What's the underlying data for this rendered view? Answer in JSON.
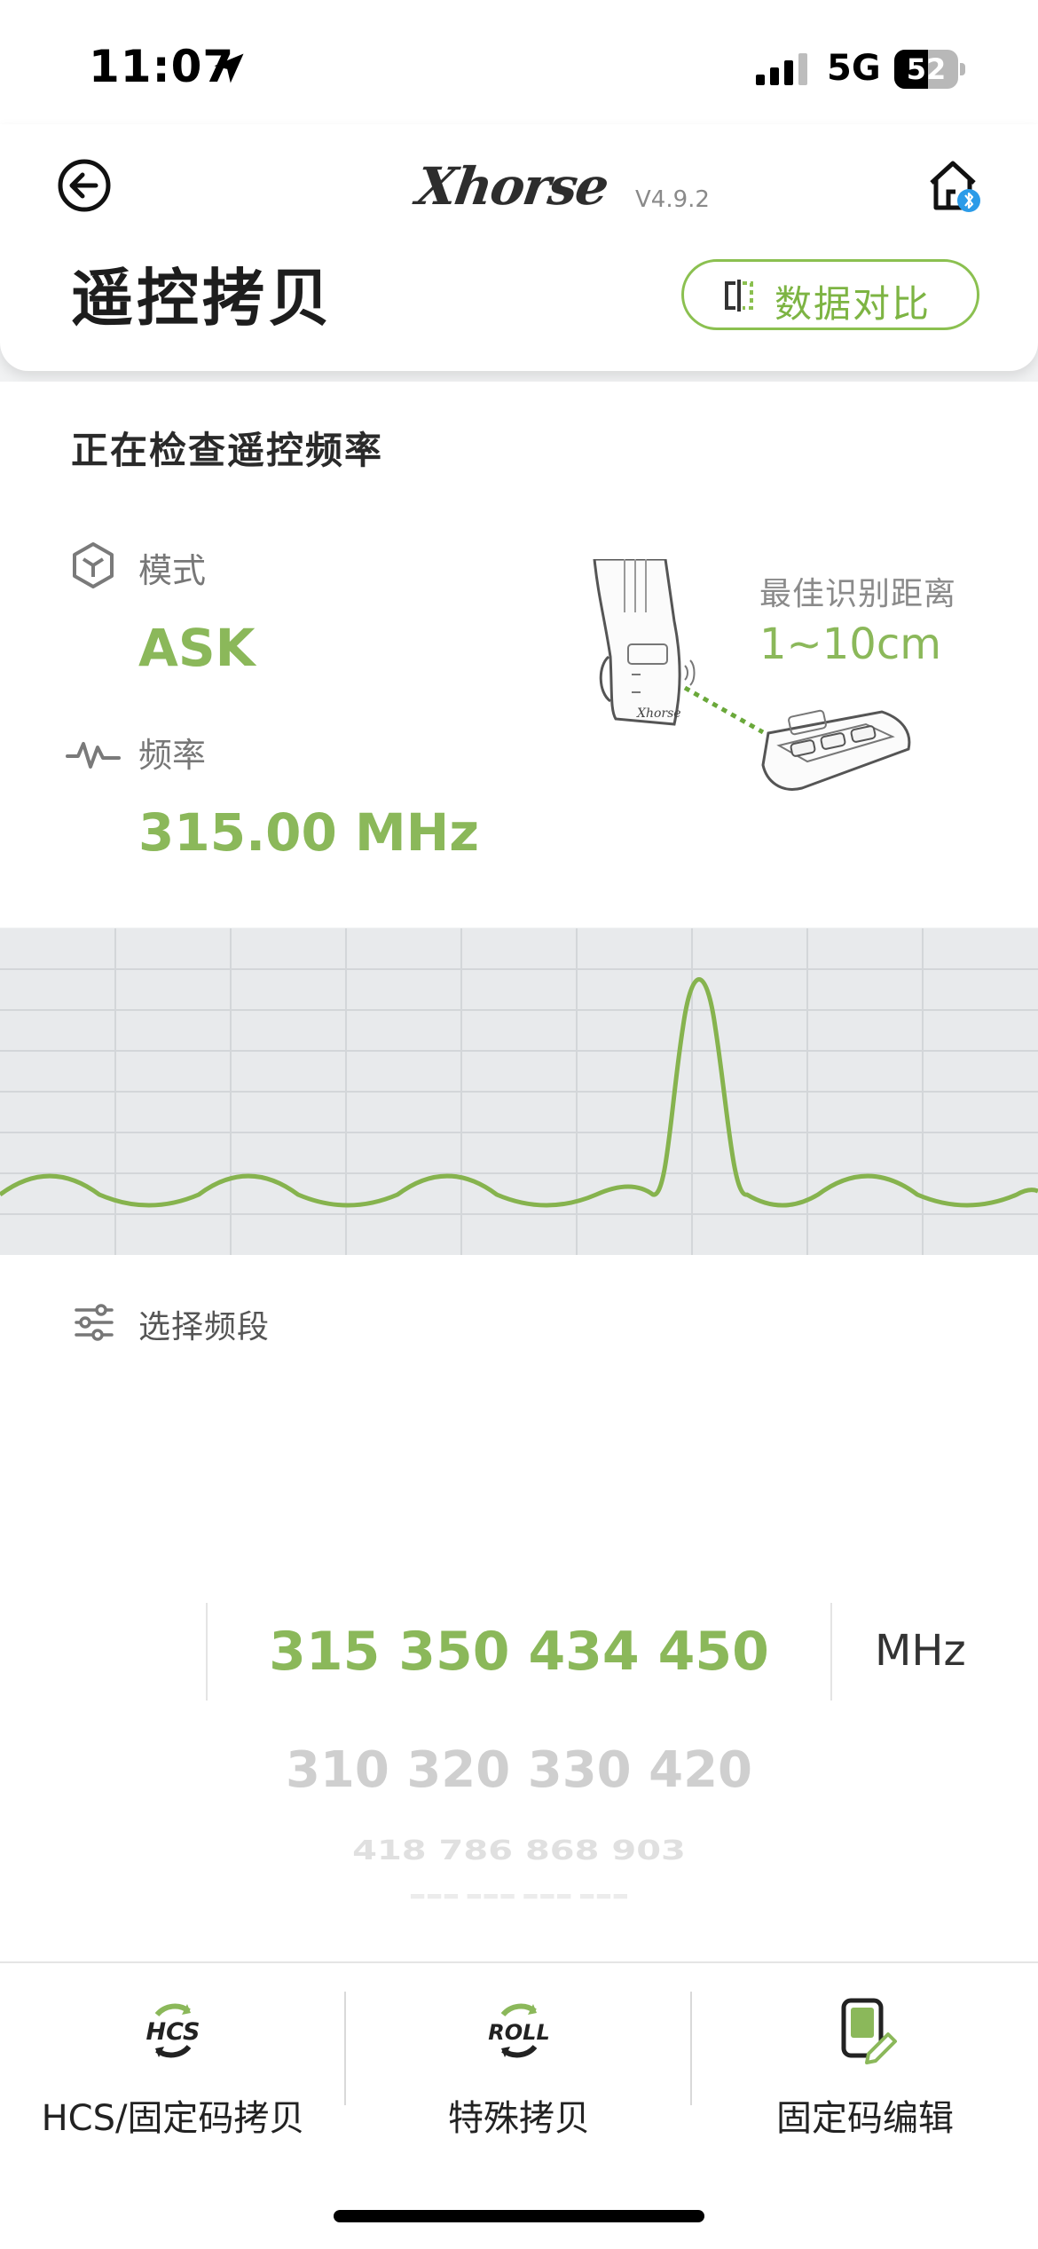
{
  "status_bar": {
    "time": "11:07",
    "network": "5G",
    "battery": "52"
  },
  "header": {
    "brand": "Xhorse",
    "version": "V4.9.2",
    "title": "遥控拷贝",
    "compare_button": "数据对比"
  },
  "detect": {
    "status_text": "正在检查遥控频率",
    "mode_label": "模式",
    "mode_value": "ASK",
    "freq_label": "频率",
    "freq_value": "315.00 MHz",
    "distance_label": "最佳识别距离",
    "distance_value": "1~10cm"
  },
  "band": {
    "label": "选择频段",
    "selected": "315 350 434 450",
    "unit": "MHz",
    "options": [
      "310 320 330 420",
      "418 786 868 903",
      "■■■ ■■■ ■■■ ■■■"
    ]
  },
  "tabs": [
    {
      "label": "HCS/固定码拷贝",
      "icon": "hcs-icon"
    },
    {
      "label": "特殊拷贝",
      "icon": "roll-icon"
    },
    {
      "label": "固定码编辑",
      "icon": "edit-icon"
    }
  ],
  "colors": {
    "accent": "#8bb85a",
    "chart_bg": "#e8eaec",
    "grid": "#d3d6d9"
  },
  "icons": [
    "location-arrow-icon",
    "signal-icon",
    "battery-icon",
    "back-icon",
    "home-bluetooth-icon",
    "compare-icon",
    "mode-cube-icon",
    "pulse-icon",
    "device-illustration",
    "settings-sliders-icon"
  ]
}
